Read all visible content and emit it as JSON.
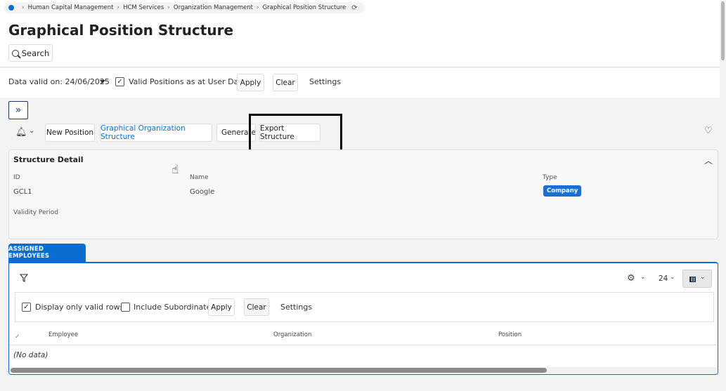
{
  "breadcrumb": {
    "items": [
      "Human Capital Management",
      "HCM Services",
      "Organization Management",
      "Graphical Position Structure"
    ]
  },
  "page_title": "Graphical Position Structure",
  "search_label": "Search",
  "filterbar": {
    "date_label": "Data valid on: 24/06/2025",
    "valid_positions_label": "Valid Positions as at User Date",
    "valid_positions_checked": true,
    "apply_label": "Apply",
    "clear_label": "Clear",
    "settings_label": "Settings"
  },
  "toolbar": {
    "new_position": "New Position",
    "graphical_org_structure": "Graphical Organization Structure",
    "generate": "Generate",
    "export_structure": "Export Structure"
  },
  "structure_detail": {
    "title": "Structure Detail",
    "id_label": "ID",
    "id_value": "GCL1",
    "name_label": "Name",
    "name_value": "Google",
    "type_label": "Type",
    "type_value": "Company",
    "validity_label": "Validity Period"
  },
  "assigned_employees": {
    "tab_label": "ASSIGNED EMPLOYEES",
    "page_size": "24",
    "display_valid_label": "Display only valid rows",
    "display_valid_checked": true,
    "include_subordinate_label": "Include Subordinate",
    "include_subordinate_checked": false,
    "apply_label": "Apply",
    "clear_label": "Clear",
    "settings_label": "Settings",
    "columns": [
      "Employee",
      "Organization",
      "Position"
    ],
    "no_data": "(No data)"
  },
  "colors": {
    "accent": "#0a6ed1",
    "badge": "#1b6fd1",
    "link": "#0a6ed1"
  }
}
